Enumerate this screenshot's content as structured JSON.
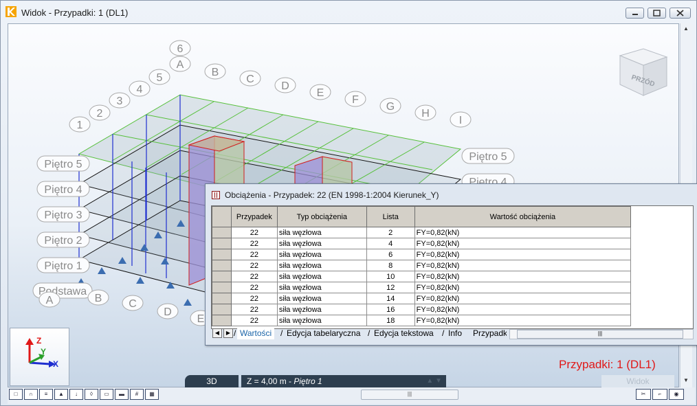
{
  "window": {
    "title": "Widok - Przypadki: 1 (DL1)"
  },
  "viewport": {
    "axis_labels_top": [
      "6",
      "A",
      "5",
      "4",
      "3",
      "2",
      "1",
      "B",
      "C",
      "D",
      "E",
      "F",
      "G",
      "H",
      "I"
    ],
    "story_labels_left": [
      "Piętro 5",
      "Piętro 4",
      "Piętro 3",
      "Piętro 2",
      "Piętro 1",
      "Podstawa"
    ],
    "story_labels_right": [
      "Piętro 5",
      "Piętro 4"
    ],
    "bottom_axis_labels": [
      "A",
      "B",
      "C",
      "D",
      "E"
    ],
    "view_cube_label": "PRZÓD",
    "case_status": "Przypadki: 1 (DL1)",
    "mode_button": "3D",
    "z_level": "Z = 4,00 m - ",
    "z_story": "Piętro 1",
    "view_tab": "Widok",
    "colors": {
      "grid_green": "#56c03a",
      "frame_blue": "#1f2fd0",
      "column_red": "#d11c1c",
      "status_red": "#e01818"
    }
  },
  "dialog": {
    "title": "Obciążenia - Przypadek: 22 (EN 1998-1:2004 Kierunek_Y)",
    "columns": [
      "Przypadek",
      "Typ obciążenia",
      "Lista",
      "Wartość obciążenia"
    ],
    "rows": [
      [
        "22",
        "siła węzłowa",
        "2",
        "FY=0,82(kN)"
      ],
      [
        "22",
        "siła węzłowa",
        "4",
        "FY=0,82(kN)"
      ],
      [
        "22",
        "siła węzłowa",
        "6",
        "FY=0,82(kN)"
      ],
      [
        "22",
        "siła węzłowa",
        "8",
        "FY=0,82(kN)"
      ],
      [
        "22",
        "siła węzłowa",
        "10",
        "FY=0,82(kN)"
      ],
      [
        "22",
        "siła węzłowa",
        "12",
        "FY=0,82(kN)"
      ],
      [
        "22",
        "siła węzłowa",
        "14",
        "FY=0,82(kN)"
      ],
      [
        "22",
        "siła węzłowa",
        "16",
        "FY=0,82(kN)"
      ],
      [
        "22",
        "siła węzłowa",
        "18",
        "FY=0,82(kN)"
      ]
    ],
    "tabs": [
      "Wartości",
      "Edycja tabelaryczna",
      "Edycja tekstowa",
      "Info",
      "Przypadki"
    ],
    "active_tab": "Wartości"
  },
  "axis_triad": {
    "x": "X",
    "y": "Y",
    "z": "Z"
  }
}
